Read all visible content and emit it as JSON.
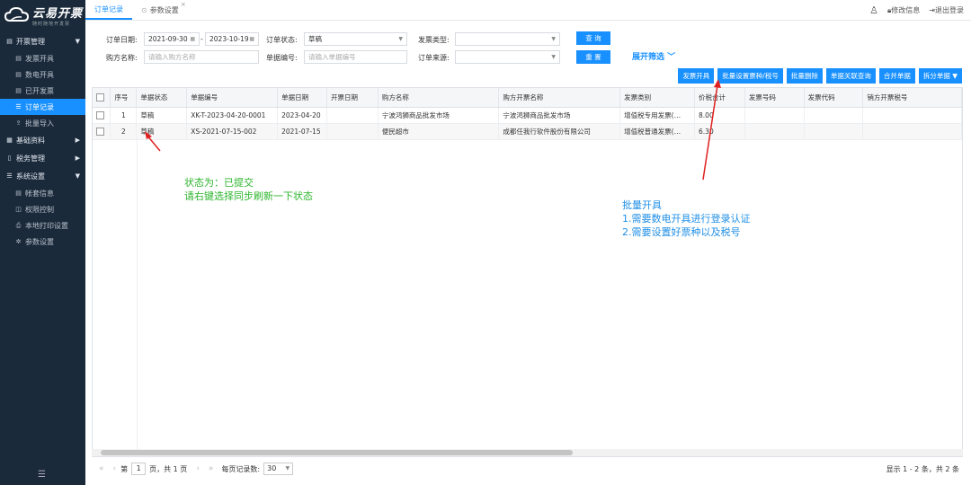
{
  "brand": {
    "title": "云易开票",
    "subtitle": "随时随地开发票"
  },
  "sidebar": {
    "groups": [
      {
        "label": "开票管理",
        "items": [
          "发票开具",
          "数电开具",
          "已开发票",
          "订单记录",
          "批量导入"
        ]
      },
      {
        "label": "基础资料",
        "items": []
      },
      {
        "label": "税务管理",
        "items": []
      },
      {
        "label": "系统设置",
        "items": [
          "帐套信息",
          "权限控制",
          "本地打印设置",
          "参数设置"
        ]
      }
    ],
    "active_item": "订单记录",
    "toggle": "☰"
  },
  "tabs": [
    {
      "label": "订单记录",
      "active": true
    },
    {
      "label": "参数设置",
      "active": false
    }
  ],
  "topbar": {
    "user_icon": "user-icon",
    "edit_label": "修改信息",
    "logout_label": "退出登录"
  },
  "filters": {
    "order_date_label": "订单日期:",
    "date_from": "2021-09-30",
    "date_sep": "-",
    "date_to": "2023-10-19",
    "order_status_label": "订单状态:",
    "order_status_value": "草稿",
    "invoice_type_label": "发票类型:",
    "invoice_type_value": "",
    "buyer_name_label": "购方名称:",
    "buyer_name_placeholder": "请输入购方名称",
    "doc_no_label": "单据编号:",
    "doc_no_placeholder": "请输入单据编号",
    "order_source_label": "订单来源:",
    "order_source_value": "",
    "query_button": "查 询",
    "reset_button": "重 置",
    "expand_label": "展开筛选 ﹀"
  },
  "toolbar": [
    "发票开具",
    "批量设置票种/税号",
    "批量删除",
    "单据关联查询",
    "合并单据",
    "拆分单据 ▼"
  ],
  "table": {
    "columns": [
      "",
      "序号",
      "单据状态",
      "单据编号",
      "单据日期",
      "开票日期",
      "购方名称",
      "购方开票名称",
      "发票类别",
      "价税合计",
      "发票号码",
      "发票代码",
      "销方开票税号"
    ],
    "rows": [
      [
        "",
        "1",
        "草稿",
        "XK-T-2023-04-20-0001",
        "2023-04-20",
        "",
        "宁波鸿狮商品批发市场",
        "宁波鸿狮商品批发市场",
        "增值税专用发票(…",
        "8.00",
        "",
        "",
        ""
      ],
      [
        "",
        "2",
        "草稿",
        "XS-2021-07-15-002",
        "2021-07-15",
        "",
        "便民超市",
        "成都任我行软件股份有限公司",
        "增值税普通发票(…",
        "6.30",
        "",
        "",
        ""
      ]
    ]
  },
  "pager": {
    "first": "«",
    "prev": "‹",
    "page_prefix": "第",
    "page_value": "1",
    "page_suffix": "页，共 1 页",
    "next": "›",
    "last": "»",
    "per_page_label": "每页记录数:",
    "per_page_value": "30",
    "summary": "显示 1 - 2 条，共 2 条"
  },
  "annotations": {
    "note1": "状态为：已提交\n请右键选择同步刷新一下状态",
    "note2": "批量开具\n1.需要数电开具进行登录认证\n2.需要设置好票种以及税号",
    "color_green": "#2db52d",
    "color_blue": "#1f8fe6",
    "color_red": "#e02020"
  }
}
